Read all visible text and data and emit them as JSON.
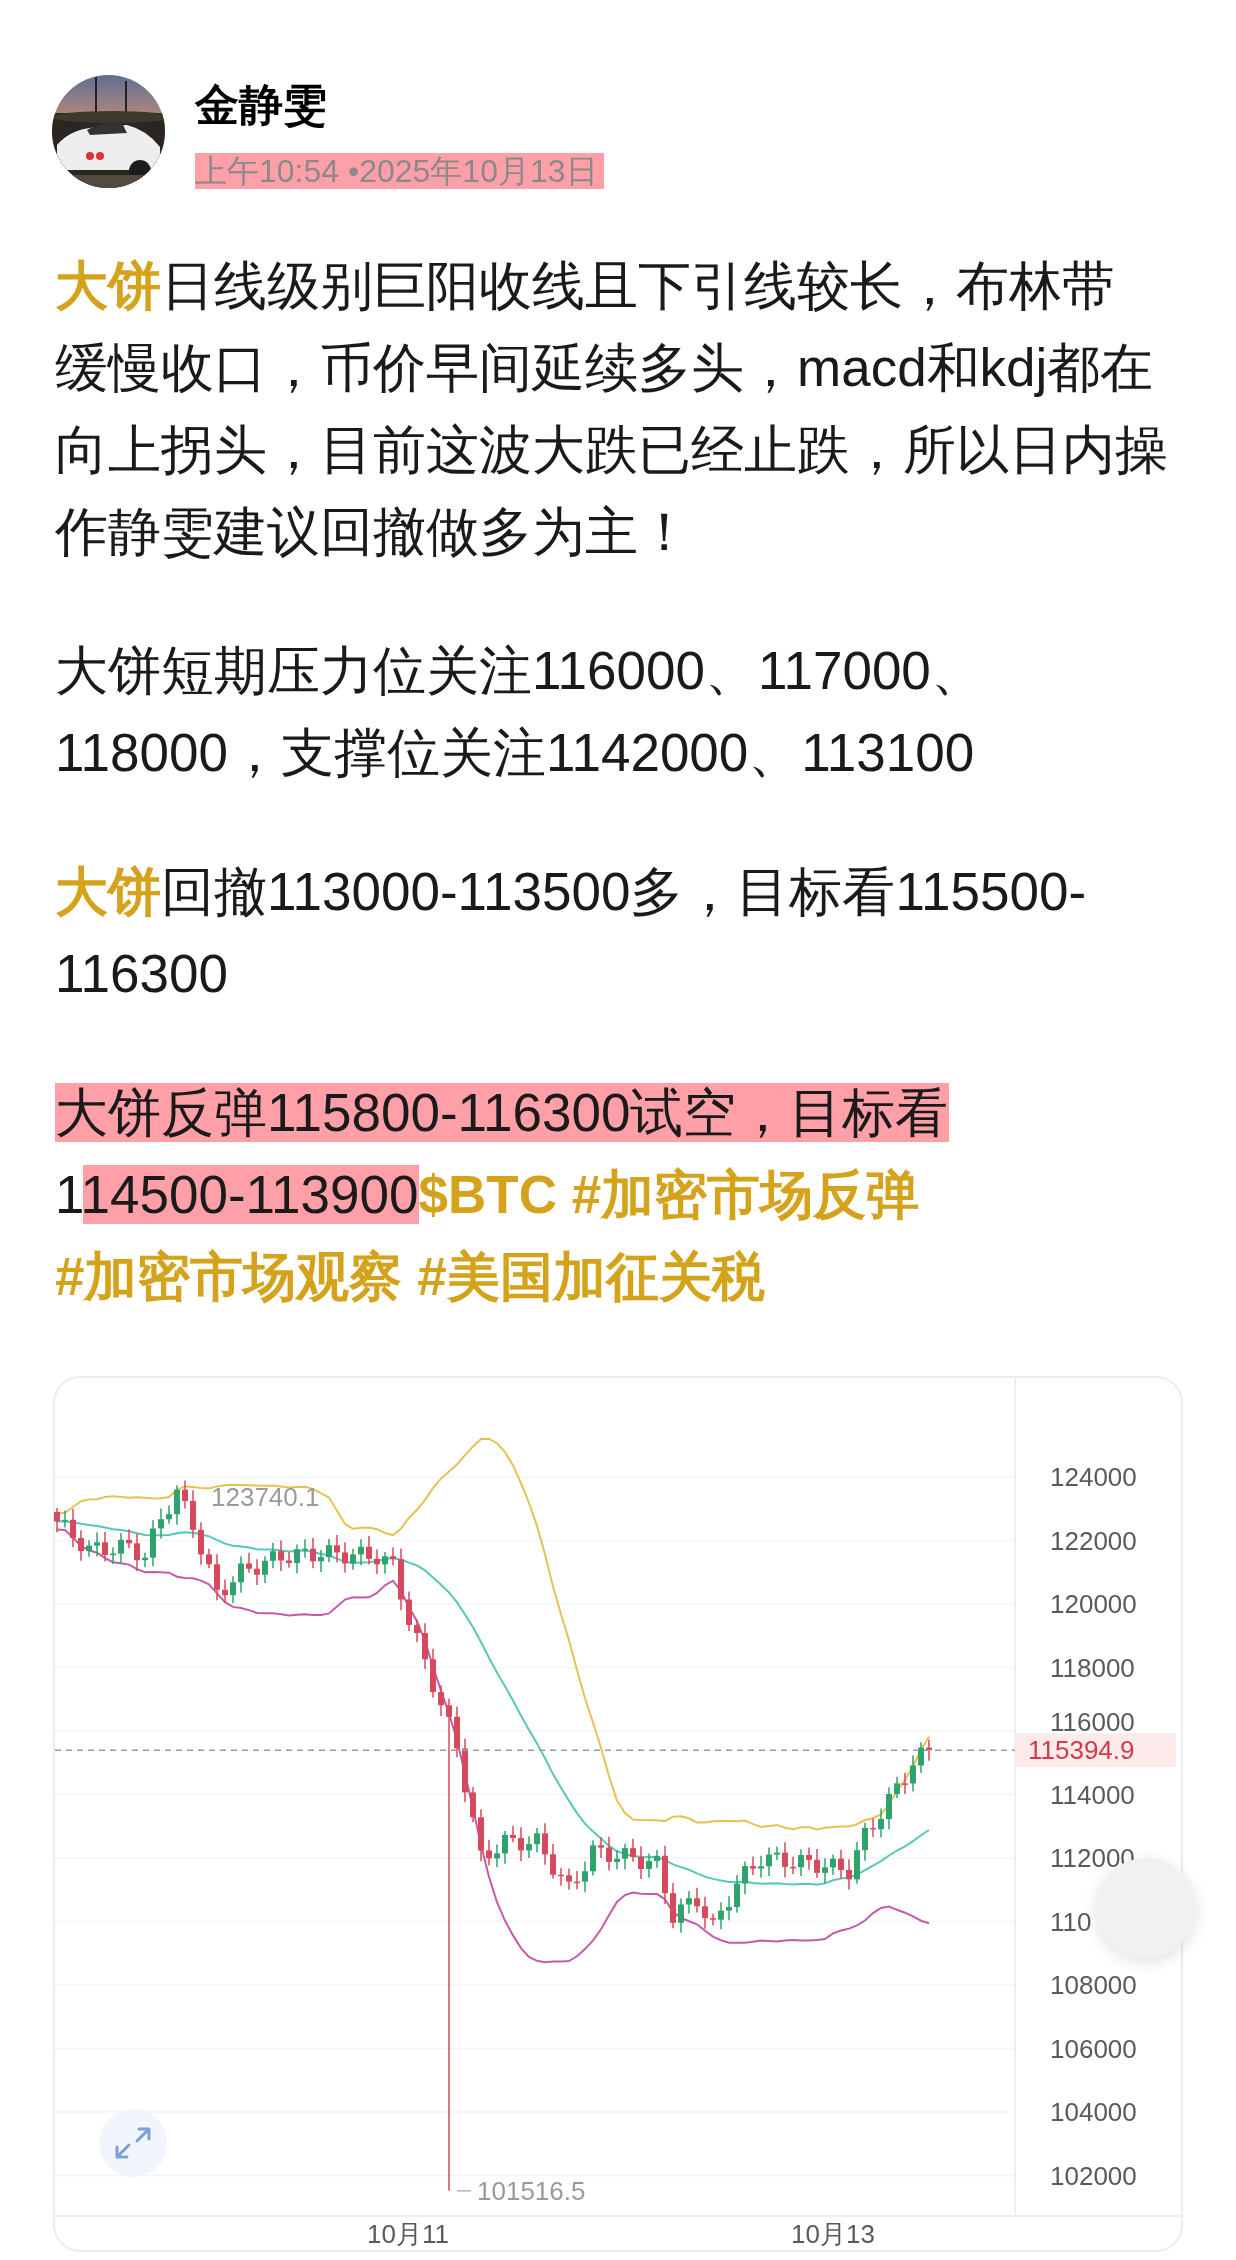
{
  "post": {
    "author": {
      "name": "金静雯"
    },
    "time": {
      "text": "上午10:54 •2025年10月13日",
      "highlighted": true
    },
    "paragraphs": [
      {
        "lines": [
          [
            {
              "kind": "coin",
              "text": "大饼",
              "highlighted": false
            },
            {
              "kind": "text",
              "text": "日线级别巨阳收线且下引线较长，布林带",
              "highlighted": false
            }
          ],
          [
            {
              "kind": "text",
              "text": "缓慢收口，币价早间延续多头，macd和kdj都在",
              "highlighted": false
            }
          ],
          [
            {
              "kind": "text",
              "text": "向上拐头，目前这波大跌已经止跌，所以日内操",
              "highlighted": false
            }
          ],
          [
            {
              "kind": "text",
              "text": "作静雯建议回撤做多为主！",
              "highlighted": false
            }
          ]
        ]
      },
      {
        "lines": [
          [
            {
              "kind": "text",
              "text": "大饼短期压力位关注116000、117000、",
              "highlighted": false
            }
          ],
          [
            {
              "kind": "text",
              "text": "118000，支撑位关注1142000、113100",
              "highlighted": false
            }
          ]
        ]
      },
      {
        "lines": [
          [
            {
              "kind": "coin",
              "text": "大饼",
              "highlighted": false
            },
            {
              "kind": "text",
              "text": "回撤113000-113500多，目标看115500-",
              "highlighted": false
            }
          ],
          [
            {
              "kind": "text",
              "text": "116300",
              "highlighted": false
            }
          ]
        ]
      },
      {
        "lines": [
          [
            {
              "kind": "text",
              "text": "大饼反弹115800-116300试空，目标看",
              "highlighted": true
            }
          ],
          [
            {
              "kind": "text",
              "text": "1",
              "highlighted": false
            },
            {
              "kind": "text",
              "text": "14500-113900",
              "highlighted": true
            },
            {
              "kind": "coin",
              "text": "$BTC",
              "highlighted": false
            },
            {
              "kind": "hashtag",
              "text": "#加密市场反弹",
              "highlighted": false
            }
          ],
          [
            {
              "kind": "hashtag",
              "text": "#加密市场观察",
              "highlighted": false
            },
            {
              "kind": "hashtag",
              "text": "#美国加征关税",
              "highlighted": false
            }
          ]
        ]
      }
    ]
  },
  "chart": {
    "high_label": "123740.1",
    "low_label": "101516.5",
    "price_label": "115394.9",
    "y_labels": [
      "124000",
      "122000",
      "120000",
      "118000",
      "116000",
      "114000",
      "112000",
      "110",
      "108000",
      "106000",
      "104000",
      "102000"
    ],
    "x_labels": [
      "10月11",
      "10月13"
    ]
  }
}
